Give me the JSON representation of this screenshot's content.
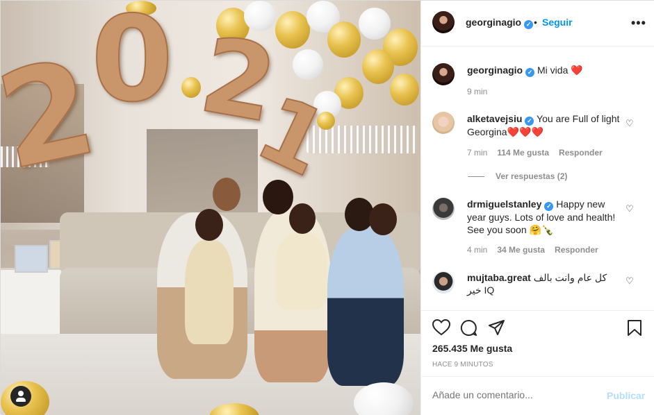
{
  "post": {
    "author": "georginagio",
    "follow_label": "Seguir",
    "more_label": "•••",
    "caption_user": "georginagio",
    "caption_text": "Mi vida ",
    "caption_emoji": "❤️",
    "caption_time": "9 min"
  },
  "comments": [
    {
      "user": "alketavejsiu",
      "text": "You are Full of light Georgina",
      "emoji": "❤️❤️❤️",
      "time": "7 min",
      "likes": "114 Me gusta",
      "reply": "Responder",
      "view_replies": "Ver respuestas (2)"
    },
    {
      "user": "drmiguelstanley",
      "text": "Happy new year guys. Lots of love and health! See you soon ",
      "emoji": "🤗🍾",
      "time": "4 min",
      "likes": "34 Me gusta",
      "reply": "Responder"
    },
    {
      "user": "mujtaba.great",
      "text": "كل عام وانت بالف خير IQ"
    }
  ],
  "actions": {
    "likes_count": "265.435 Me gusta",
    "posted_ago": "HACE 9 MINUTOS"
  },
  "add_comment": {
    "placeholder": "Añade un comentario...",
    "publish_label": "Publicar"
  },
  "photo": {
    "balloon_digits": [
      "2",
      "0",
      "2",
      "1"
    ]
  },
  "colors": {
    "link_blue": "#0095f6",
    "verified_blue": "#3897f0",
    "heart_red": "#ed4956",
    "muted_gray": "#8e8e8e",
    "publish_disabled": "#b2dffc"
  }
}
